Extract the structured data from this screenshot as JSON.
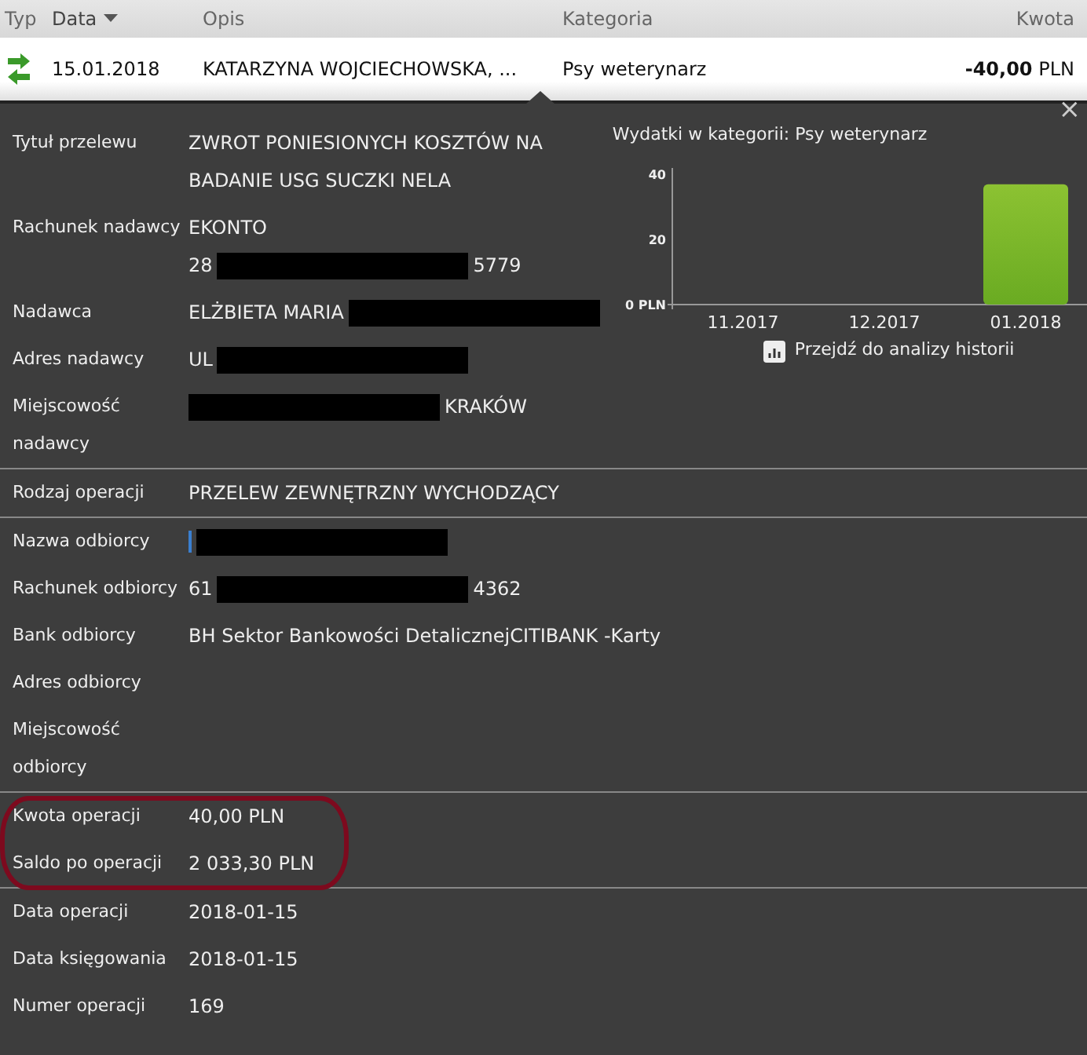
{
  "table": {
    "columns": [
      {
        "label": "Typ",
        "sorted": false
      },
      {
        "label": "Data",
        "sorted": true
      },
      {
        "label": "Opis",
        "sorted": false
      },
      {
        "label": "Kategoria",
        "sorted": false
      },
      {
        "label": "Kwota",
        "sorted": false
      }
    ],
    "row": {
      "date": "15.01.2018",
      "description": "KATARZYNA WOJCIECHOWSKA, ...",
      "category": "Psy weterynarz",
      "amount": "**-40,00** PLN",
      "expanded": true
    }
  },
  "details": {
    "close": "×",
    "sections": [
      {
        "highlighted": false,
        "rows": [
          {
            "label": "Tytuł przelewu",
            "values": [
              [
                {
                  "kind": "text",
                  "text": "ZWROT PONIESIONYCH KOSZTÓW NA"
                }
              ],
              [
                {
                  "kind": "text",
                  "text": "BADANIE USG SUCZKI NELA"
                }
              ]
            ]
          },
          {
            "label": "Rachunek nadawcy",
            "values": [
              [
                {
                  "kind": "text",
                  "text": "EKONTO"
                }
              ],
              [
                {
                  "kind": "text",
                  "text": "28"
                },
                {
                  "kind": "redaction"
                },
                {
                  "kind": "text",
                  "text": "5779"
                }
              ]
            ]
          },
          {
            "label": "Nadawca",
            "values": [
              [
                {
                  "kind": "text",
                  "text": "ELŻBIETA MARIA"
                },
                {
                  "kind": "redaction"
                }
              ]
            ]
          },
          {
            "label": "Adres nadawcy",
            "values": [
              [
                {
                  "kind": "text",
                  "text": "UL"
                },
                {
                  "kind": "redaction"
                }
              ]
            ]
          },
          {
            "label": "Miejscowość nadawcy",
            "values": [
              [
                {
                  "kind": "redaction"
                },
                {
                  "kind": "text",
                  "text": "KRAKÓW"
                }
              ]
            ]
          }
        ]
      },
      {
        "highlighted": false,
        "rows": [
          {
            "label": "Rodzaj operacji",
            "values": [
              [
                {
                  "kind": "text",
                  "text": "PRZELEW ZEWNĘTRZNY WYCHODZĄCY"
                }
              ]
            ]
          }
        ]
      },
      {
        "highlighted": false,
        "rows": [
          {
            "label": "Nazwa odbiorcy",
            "values": [
              [
                {
                  "kind": "caret"
                },
                {
                  "kind": "redaction"
                }
              ]
            ]
          },
          {
            "label": "Rachunek odbiorcy",
            "values": [
              [
                {
                  "kind": "text",
                  "text": "61"
                },
                {
                  "kind": "redaction"
                },
                {
                  "kind": "text",
                  "text": "4362"
                }
              ]
            ]
          },
          {
            "label": "Bank odbiorcy",
            "values": [
              [
                {
                  "kind": "text",
                  "text": "BH Sektor Bankowości DetalicznejCITIBANK -Karty"
                }
              ]
            ]
          },
          {
            "label": "Adres odbiorcy",
            "values": []
          },
          {
            "label": "Miejscowość odbiorcy",
            "values": []
          }
        ]
      },
      {
        "highlighted": true,
        "rows": [
          {
            "label": "Kwota operacji",
            "values": [
              [
                {
                  "kind": "text",
                  "text": "40,00 PLN"
                }
              ]
            ]
          },
          {
            "label": "Saldo po operacji",
            "values": [
              [
                {
                  "kind": "text",
                  "text": "2 033,30 PLN"
                }
              ]
            ]
          }
        ]
      },
      {
        "highlighted": false,
        "rows": [
          {
            "label": "Data operacji",
            "values": [
              [
                {
                  "kind": "text",
                  "text": "2018-01-15"
                }
              ]
            ]
          },
          {
            "label": "Data księgowania",
            "values": [
              [
                {
                  "kind": "text",
                  "text": "2018-01-15"
                }
              ]
            ]
          },
          {
            "label": "Numer operacji",
            "values": [
              [
                {
                  "kind": "text",
                  "text": "169"
                }
              ]
            ]
          }
        ]
      }
    ],
    "chart_title": "Wydatki w kategorii:  Psy weterynarz",
    "chart_data": {
      "type": "bar",
      "categories": [
        "11.2017",
        "12.2017",
        "01.2018"
      ],
      "series": [
        {
          "color": "#6aab22",
          "values": [
            0,
            0,
            37
          ]
        }
      ],
      "ylim": [
        0,
        42
      ],
      "yticks": [
        {
          "value": 0,
          "label": "0 PLN"
        },
        20,
        40
      ]
    },
    "history_link": "Przejdź do analizy historii"
  }
}
